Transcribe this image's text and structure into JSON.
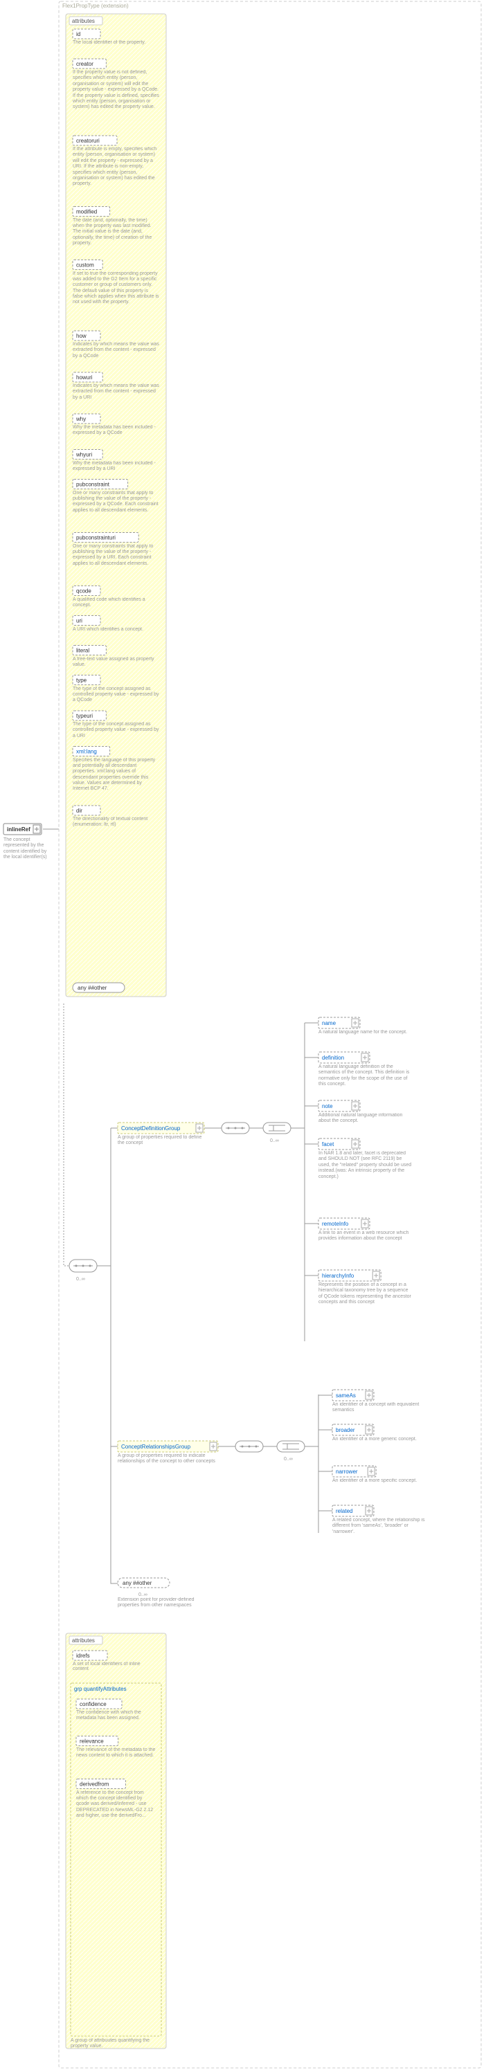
{
  "root": {
    "name": "inlineRef",
    "desc": "The concept represented by the content identified by the local identifier(s)"
  },
  "header": "Flex1PropType (extension)",
  "attributesLabel": "attributes",
  "attrs": [
    {
      "name": "id",
      "desc": "The local identifier of the property."
    },
    {
      "name": "creator",
      "desc": "If the property value is not defined, specifies which entity (person, organisation or system) will edit the property value - expressed by a QCode. If the property value is defined, specifies which entity (person, organisation or system) has edited the property value."
    },
    {
      "name": "creatoruri",
      "desc": "If the attribute is empty, specifies which entity (person, organisation or system) will edit the property - expressed by a URI. If the attribute is non-empty, specifies which entity (person, organisation or system) has edited the property."
    },
    {
      "name": "modified",
      "desc": "The date (and, optionally, the time) when the property was last modified. The initial value is the date (and, optionally, the time) of creation of the property."
    },
    {
      "name": "custom",
      "desc": "If set to true the corresponding property was added to the G2 Item for a specific customer or group of customers only. The default value of this property is false which applies when this attribute is not used with the property."
    },
    {
      "name": "how",
      "desc": "Indicates by which means the value was extracted from the content - expressed by a QCode"
    },
    {
      "name": "howuri",
      "desc": "Indicates by which means the value was extracted from the content - expressed by a URI"
    },
    {
      "name": "why",
      "desc": "Why the metadata has been included - expressed by a QCode"
    },
    {
      "name": "whyuri",
      "desc": "Why the metadata has been included - expressed by a URI"
    },
    {
      "name": "pubconstraint",
      "desc": "One or many constraints that apply to publishing the value of the property - expressed by a QCode. Each constraint applies to all descendant elements."
    },
    {
      "name": "pubconstrainturi",
      "desc": "One or many constraints that apply to publishing the value of the property - expressed by a URI. Each constraint applies to all descendant elements."
    },
    {
      "name": "qcode",
      "desc": "A qualified code which identifies a concept."
    },
    {
      "name": "uri",
      "desc": "A URI which identifies a concept."
    },
    {
      "name": "literal",
      "desc": "A free-text value assigned as property value."
    },
    {
      "name": "type",
      "desc": "The type of the concept assigned as controlled property value - expressed by a QCode"
    },
    {
      "name": "typeuri",
      "desc": "The type of the concept assigned as controlled property value - expressed by a URI"
    },
    {
      "name": "xml:lang",
      "desc": "Specifies the language of this property and potentially all descendant properties. xml:lang values of descendant properties override this value. Values are determined by Internet BCP 47.",
      "link": true
    },
    {
      "name": "dir",
      "desc": "The directionality of textual content (enumeration: ltr, rtl)"
    }
  ],
  "anyOther": "any ##other",
  "groups": {
    "cdg": {
      "name": "ConceptDefinitionGroup",
      "desc": "A group of properties required to define the concept",
      "card": "0..∞"
    },
    "crg": {
      "name": "ConceptRelationshipsGroup",
      "desc": "A group of properties required to indicate relationships of the concept to other concepts",
      "card": "0..∞"
    },
    "extAny": {
      "label": "any ##other",
      "desc": "Extension point for provider-defined properties from other namespaces",
      "card": "0..∞"
    }
  },
  "cdgChildren": [
    {
      "name": "name",
      "desc": "A natural language name for the concept."
    },
    {
      "name": "definition",
      "desc": "A natural language definition of the semantics of the concept. This definition is normative only for the scope of the use of this concept."
    },
    {
      "name": "note",
      "desc": "Additional natural language information about the concept."
    },
    {
      "name": "facet",
      "desc": "In NAR 1.8 and later, facet is deprecated and SHOULD NOT (see RFC 2119) be used, the \"related\" property should be used instead.(was: An intrinsic property of the concept.)"
    },
    {
      "name": "remoteInfo",
      "desc": "A link to an event in a web resource which provides information about the concept"
    },
    {
      "name": "hierarchyInfo",
      "desc": "Represents the position of a concept in a hierarchical taxonomy tree by a sequence of QCode tokens representing the ancestor concepts and this concept"
    }
  ],
  "crgChildren": [
    {
      "name": "sameAs",
      "desc": "An identifier of a concept with equivalent semantics"
    },
    {
      "name": "broader",
      "desc": "An identifier of a more generic concept."
    },
    {
      "name": "narrower",
      "desc": "An identifier of a more specific concept."
    },
    {
      "name": "related",
      "desc": "A related concept, where the relationship is different from 'sameAs', 'broader' or 'narrower'."
    }
  ],
  "idrefs": {
    "title": "attributes",
    "name": "idrefs",
    "desc": "A set of local identifiers of inline content"
  },
  "quant": {
    "heading": "grp quantifyAttributes",
    "items": [
      {
        "name": "confidence",
        "desc": "The confidence with which the metadata has been assigned."
      },
      {
        "name": "relevance",
        "desc": "The relevance of the metadata to the news content to which it is attached."
      },
      {
        "name": "derivedfrom",
        "desc": "A reference to the concept from which the concept identified by qcode was derived/inferred - use DEPRECATED in NewsML-G2 2.12 and higher, use the derivedFro..."
      }
    ],
    "footer": "A group of attribuutes quantifying the property value."
  },
  "sequenceCard": "0..∞"
}
